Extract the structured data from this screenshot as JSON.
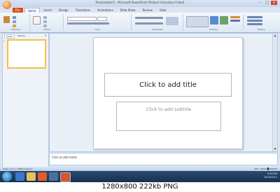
{
  "window": {
    "title": "Presentation1 - Microsoft PowerPoint (Product Activation Failed)"
  },
  "ribbon_tabs": [
    "File",
    "Home",
    "Insert",
    "Design",
    "Transitions",
    "Animations",
    "Slide Show",
    "Review",
    "View"
  ],
  "ribbon_groups": [
    "Clipboard",
    "Slides",
    "Font",
    "Paragraph",
    "Drawing",
    "Editing"
  ],
  "left_panel": {
    "tabs": [
      "Slides",
      "Outline"
    ],
    "slide_number": "1"
  },
  "slide": {
    "title_placeholder": "Click to add title",
    "subtitle_placeholder": "Click to add subtitle"
  },
  "notes": {
    "placeholder": "Click to add notes"
  },
  "status": {
    "slide_info": "Slide 1 of 1",
    "theme": "\"Office Theme\"",
    "zoom": "69%"
  },
  "taskbar": {
    "time": "3:56 PM",
    "date": "8/25/2011"
  },
  "caption": "1280x800  222kb  PNG",
  "colors": {
    "accent": "#f2c242",
    "ribbon": "#dde8f5",
    "taskbar": "#1e3a5f"
  }
}
